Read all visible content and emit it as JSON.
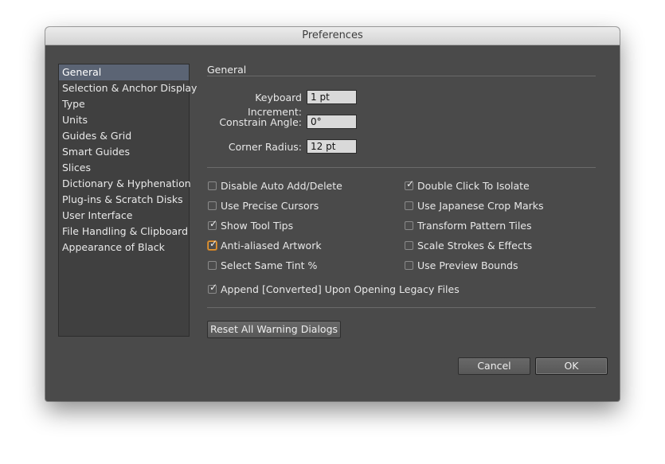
{
  "window": {
    "title": "Preferences"
  },
  "sidebar": {
    "items": [
      {
        "label": "General",
        "selected": true
      },
      {
        "label": "Selection & Anchor Display"
      },
      {
        "label": "Type"
      },
      {
        "label": "Units"
      },
      {
        "label": "Guides & Grid"
      },
      {
        "label": "Smart Guides"
      },
      {
        "label": "Slices"
      },
      {
        "label": "Dictionary & Hyphenation"
      },
      {
        "label": "Plug-ins & Scratch Disks"
      },
      {
        "label": "User Interface"
      },
      {
        "label": "File Handling & Clipboard"
      },
      {
        "label": "Appearance of Black"
      }
    ]
  },
  "general": {
    "title": "General",
    "fields": {
      "keyboard_increment": {
        "label": "Keyboard Increment:",
        "value": "1 pt"
      },
      "constrain_angle": {
        "label": "Constrain Angle:",
        "value": "0°"
      },
      "corner_radius": {
        "label": "Corner Radius:",
        "value": "12 pt"
      }
    },
    "options": {
      "disable_auto_add_delete": {
        "label": "Disable Auto Add/Delete",
        "checked": false
      },
      "use_precise_cursors": {
        "label": "Use Precise Cursors",
        "checked": false
      },
      "show_tool_tips": {
        "label": "Show Tool Tips",
        "checked": true
      },
      "anti_aliased_artwork": {
        "label": "Anti-aliased Artwork",
        "checked": true,
        "focused": true
      },
      "select_same_tint": {
        "label": "Select Same Tint %",
        "checked": false
      },
      "double_click_to_isolate": {
        "label": "Double Click To Isolate",
        "checked": true
      },
      "use_japanese_crop_marks": {
        "label": "Use Japanese Crop Marks",
        "checked": false
      },
      "transform_pattern_tiles": {
        "label": "Transform Pattern Tiles",
        "checked": false
      },
      "scale_strokes_effects": {
        "label": "Scale Strokes & Effects",
        "checked": false
      },
      "use_preview_bounds": {
        "label": "Use Preview Bounds",
        "checked": false
      },
      "append_converted": {
        "label": "Append [Converted] Upon Opening Legacy Files",
        "checked": true
      }
    },
    "tick_glyph": "✓",
    "reset_button": "Reset All Warning Dialogs"
  },
  "footer": {
    "cancel": "Cancel",
    "ok": "OK"
  },
  "colors": {
    "panel": "#4a4a4a",
    "selection": "#5b6474",
    "focus": "#e39b3a"
  }
}
